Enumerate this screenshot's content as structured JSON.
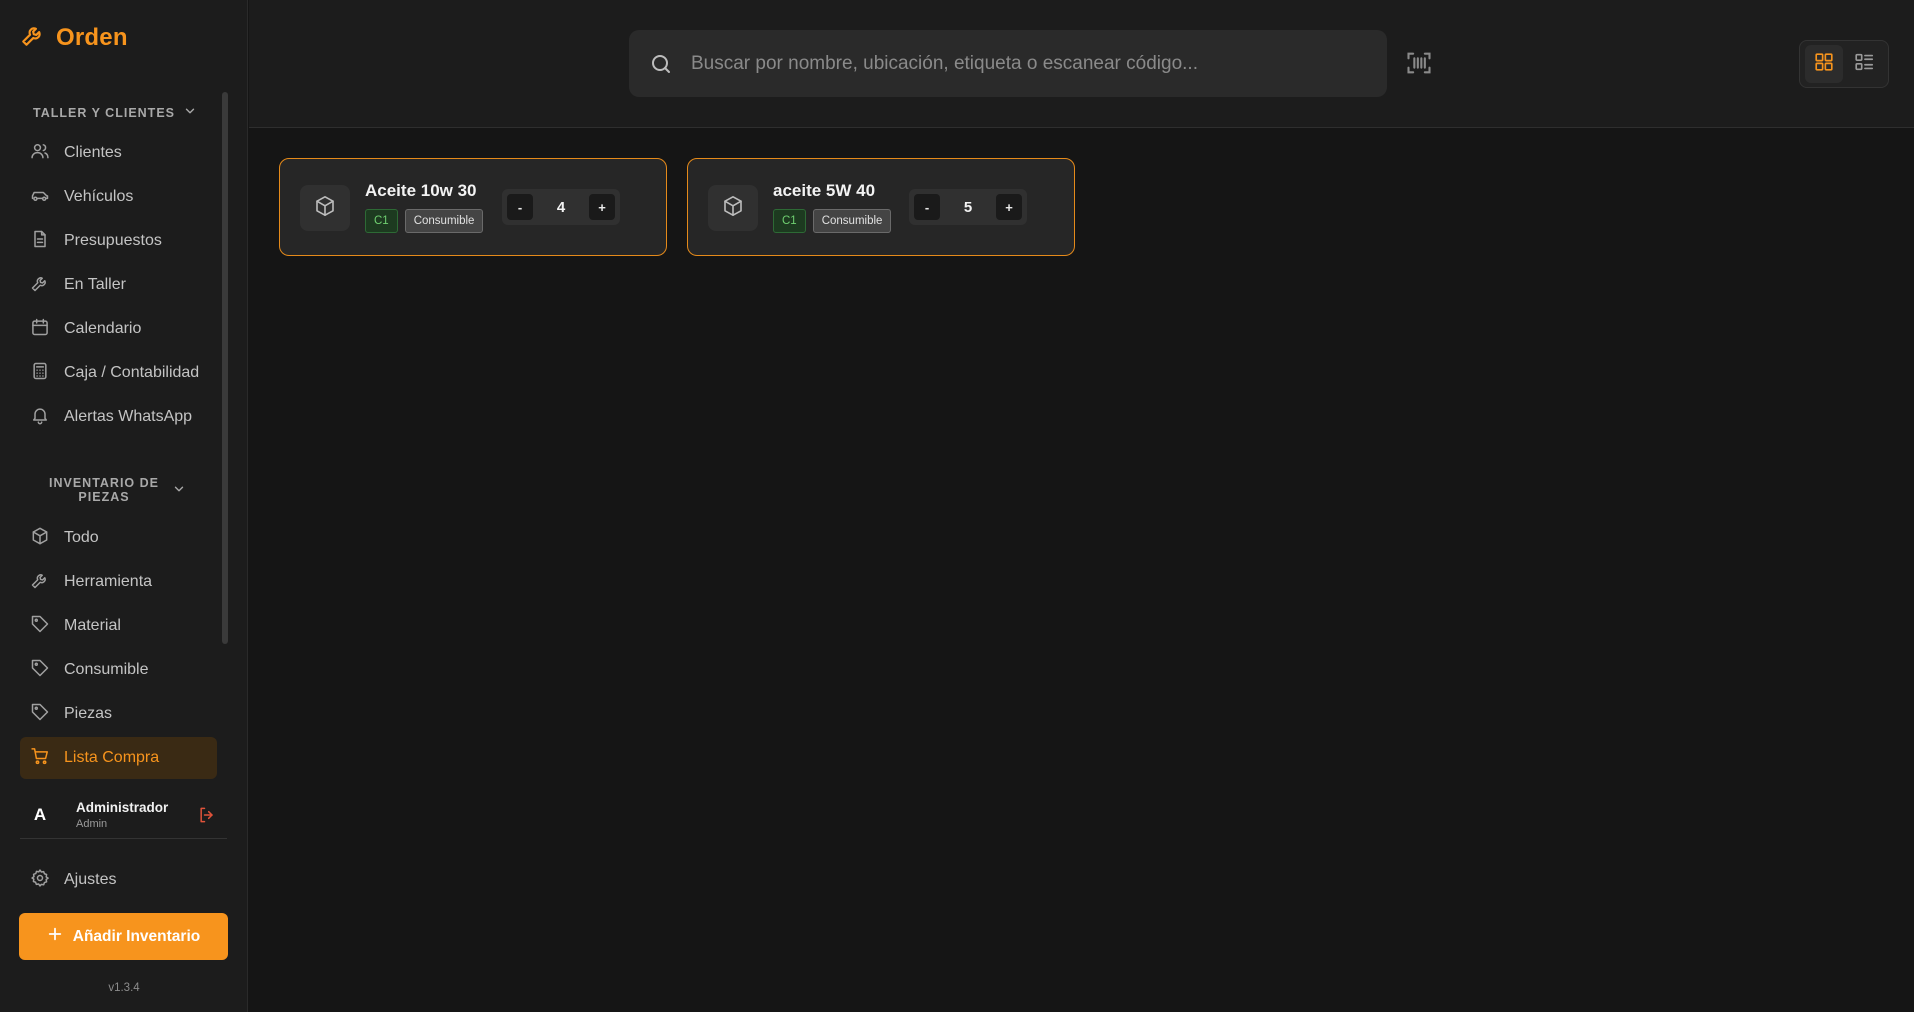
{
  "brand": {
    "title": "Orden",
    "icon": "wrench-icon",
    "accent": "#f7941d"
  },
  "sidebar": {
    "section1": {
      "label": "TALLER Y CLIENTES"
    },
    "items1": [
      {
        "label": "Clientes",
        "icon": "users-icon"
      },
      {
        "label": "Vehículos",
        "icon": "car-icon"
      },
      {
        "label": "Presupuestos",
        "icon": "document-icon"
      },
      {
        "label": "En Taller",
        "icon": "wrench-icon"
      },
      {
        "label": "Calendario",
        "icon": "calendar-icon"
      },
      {
        "label": "Caja / Contabilidad",
        "icon": "calculator-icon"
      },
      {
        "label": "Alertas WhatsApp",
        "icon": "bell-icon"
      }
    ],
    "section2": {
      "label": "INVENTARIO DE PIEZAS"
    },
    "items2": [
      {
        "label": "Todo",
        "icon": "box-icon"
      },
      {
        "label": "Herramienta",
        "icon": "wrench-icon"
      },
      {
        "label": "Material",
        "icon": "tag-icon"
      },
      {
        "label": "Consumible",
        "icon": "tag-icon"
      },
      {
        "label": "Piezas",
        "icon": "tag-icon"
      },
      {
        "label": "Lista Compra",
        "icon": "cart-icon",
        "active": true
      }
    ],
    "user": {
      "initial": "A",
      "name": "Administrador",
      "role": "Admin"
    },
    "settings_label": "Ajustes",
    "add_button_label": "Añadir Inventario",
    "version": "v1.3.4"
  },
  "header": {
    "search": {
      "placeholder": "Buscar por nombre, ubicación, etiqueta o escanear código..."
    },
    "view_mode": "grid"
  },
  "items": [
    {
      "name": "Aceite 10w 30",
      "location": "C1",
      "category": "Consumible",
      "quantity": "4",
      "minus": "-",
      "plus": "+"
    },
    {
      "name": "aceite 5W 40",
      "location": "C1",
      "category": "Consumible",
      "quantity": "5",
      "minus": "-",
      "plus": "+"
    }
  ]
}
